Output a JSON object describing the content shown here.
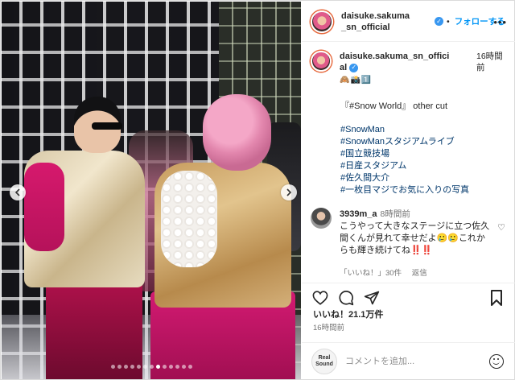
{
  "post": {
    "author": "daisuke.sakuma_sn_official",
    "author_header_line1": "daisuke.sakuma",
    "author_header_line2": "_sn_official",
    "follow_label": "フォローする",
    "separator": "•",
    "more_label": "•••",
    "caption": {
      "author_line1": "daisuke.sakuma_sn_offici",
      "author_line2": "al",
      "time_line1": "16時間",
      "time_line2": "前",
      "emoji": "🙈📸1️⃣",
      "text": "『#Snow World』 other cut",
      "hashtags": [
        "#SnowMan",
        "#SnowManスタジアムライブ",
        "#国立競技場",
        "#日産スタジアム",
        "#佐久間大介",
        "#一枚目マジでお気に入りの写真"
      ]
    },
    "comment": {
      "user": "3939m_a",
      "time": "8時間前",
      "text": "こうやって大きなステージに立つ佐久間くんが見れて幸せだよ🥲🥲これからも輝き続けてね",
      "exclaim": "‼️‼️",
      "likes": "「いいね！」30件",
      "reply_label": "返信"
    },
    "likes_text": "いいね！21.1万件",
    "posted": "16時間前",
    "comment_placeholder": "コメントを追加...",
    "commenter_avatar_text": "Real Sound"
  },
  "carousel": {
    "slide_count": 13,
    "active_index": 7
  },
  "colors": {
    "accent": "#0095f6",
    "verified": "#3897f0",
    "hashtag": "#00376b",
    "muted": "#737373"
  },
  "icons": [
    "chevron-left-icon",
    "chevron-right-icon",
    "verified-icon",
    "heart-icon",
    "comment-icon",
    "share-icon",
    "bookmark-icon",
    "emoji-icon",
    "more-icon"
  ]
}
